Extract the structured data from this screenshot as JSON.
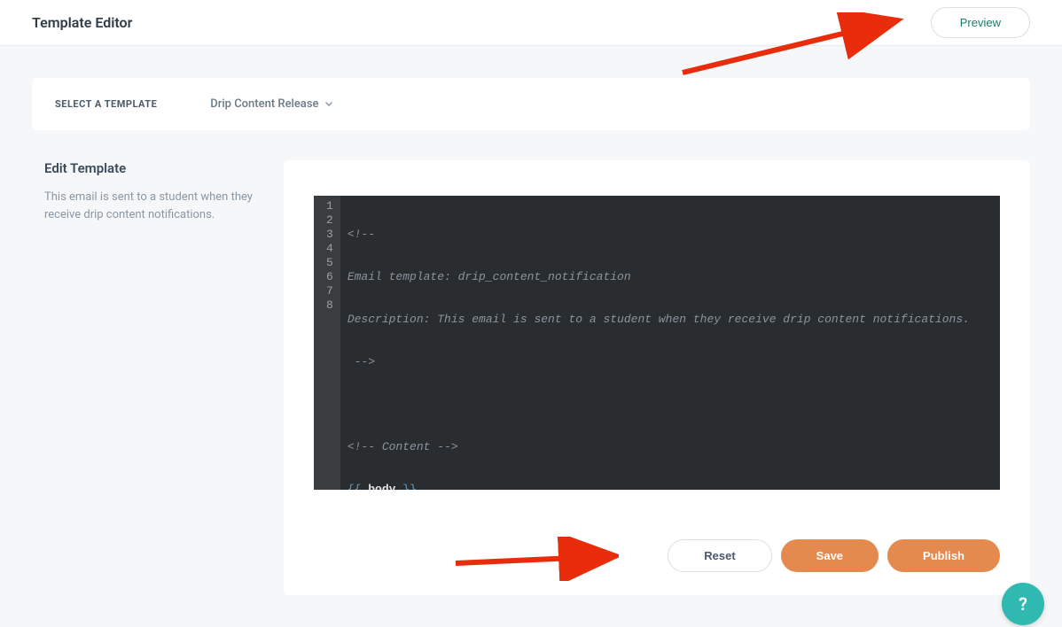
{
  "header": {
    "title": "Template Editor",
    "preview_label": "Preview"
  },
  "select_card": {
    "label": "SELECT A TEMPLATE",
    "selected": "Drip Content Release"
  },
  "left": {
    "title": "Edit Template",
    "description": "This email is sent to a student when they receive drip content notifications."
  },
  "code": {
    "lines": [
      "1",
      "2",
      "3",
      "4",
      "5",
      "6",
      "7",
      "8"
    ],
    "l1": "<!--",
    "l2": "Email template: drip_content_notification",
    "l3": "Description: This email is sent to a student when they receive drip content notifications.",
    "l4": " -->",
    "l5": "",
    "l6": "<!-- Content -->",
    "l7_open": "{{",
    "l7_body": " body ",
    "l7_close": "}}",
    "l8": ""
  },
  "actions": {
    "reset": "Reset",
    "save": "Save",
    "publish": "Publish"
  },
  "help": {
    "label": "?"
  }
}
